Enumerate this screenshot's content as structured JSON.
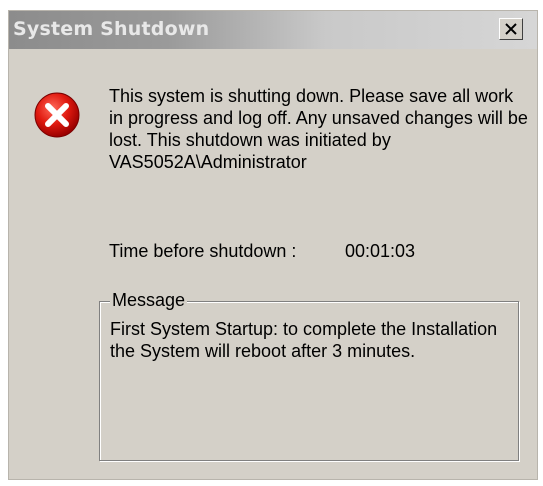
{
  "window": {
    "title": "System Shutdown",
    "close_icon": "close-icon"
  },
  "dialog": {
    "icon": "error-icon",
    "message": "This system is shutting down. Please save all work in progress and log off. Any unsaved changes will be lost. This shutdown was initiated by VAS5052A\\Administrator",
    "time_label": "Time before shutdown :",
    "time_value": "00:01:03"
  },
  "message_group": {
    "legend": "Message",
    "text": "First System Startup: to complete the Installation the System will reboot after 3 minutes."
  },
  "colors": {
    "dialog_bg": "#d4d0c8",
    "error_red": "#cc0000"
  }
}
